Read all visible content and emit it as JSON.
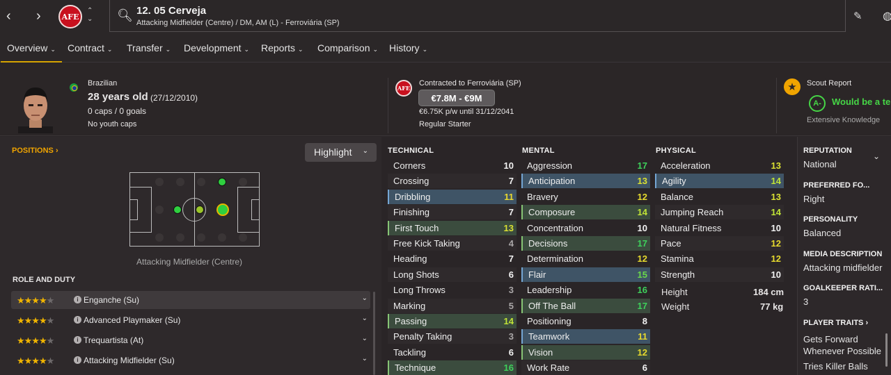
{
  "header": {
    "name": "12. 05 Cerveja",
    "subtitle": "Attacking Midfielder (Centre) / DM, AM (L) - Ferroviária (SP)",
    "club_crest": "AFE"
  },
  "tabs": [
    {
      "label": "Overview"
    },
    {
      "label": "Contract"
    },
    {
      "label": "Transfer"
    },
    {
      "label": "Development"
    },
    {
      "label": "Reports"
    },
    {
      "label": "Comparison"
    },
    {
      "label": "History"
    }
  ],
  "profile": {
    "nationality": "Brazilian",
    "age": "28 years old",
    "dob": "(27/12/2010)",
    "caps": "0 caps / 0 goals",
    "youth_caps": "No youth caps"
  },
  "contract": {
    "club": "Contracted to Ferroviária (SP)",
    "value": "€7.8M - €9M",
    "wage": "€6.75K p/w until 31/12/2041",
    "status": "Regular Starter"
  },
  "scout": {
    "title": "Scout Report",
    "grade": "A-",
    "summary": "Would be a ter",
    "knowledge": "Extensive Knowledge"
  },
  "positions": {
    "title": "POSITIONS",
    "highlight": "Highlight",
    "label": "Attacking Midfielder (Centre)"
  },
  "roles": {
    "title": "ROLE AND DUTY",
    "items": [
      {
        "name": "Enganche (Su)",
        "stars": 4
      },
      {
        "name": "Advanced Playmaker (Su)",
        "stars": 4
      },
      {
        "name": "Trequartista (At)",
        "stars": 4
      },
      {
        "name": "Attacking Midfielder (Su)",
        "stars": 4
      }
    ]
  },
  "technical": {
    "title": "TECHNICAL",
    "items": [
      {
        "name": "Corners",
        "value": "10",
        "hl": ""
      },
      {
        "name": "Crossing",
        "value": "7",
        "hl": ""
      },
      {
        "name": "Dribbling",
        "value": "11",
        "hl": "blue"
      },
      {
        "name": "Finishing",
        "value": "7",
        "hl": ""
      },
      {
        "name": "First Touch",
        "value": "13",
        "hl": "green"
      },
      {
        "name": "Free Kick Taking",
        "value": "4",
        "hl": ""
      },
      {
        "name": "Heading",
        "value": "7",
        "hl": ""
      },
      {
        "name": "Long Shots",
        "value": "6",
        "hl": ""
      },
      {
        "name": "Long Throws",
        "value": "3",
        "hl": ""
      },
      {
        "name": "Marking",
        "value": "5",
        "hl": ""
      },
      {
        "name": "Passing",
        "value": "14",
        "hl": "green"
      },
      {
        "name": "Penalty Taking",
        "value": "3",
        "hl": ""
      },
      {
        "name": "Tackling",
        "value": "6",
        "hl": ""
      },
      {
        "name": "Technique",
        "value": "16",
        "hl": "green"
      }
    ]
  },
  "mental": {
    "title": "MENTAL",
    "items": [
      {
        "name": "Aggression",
        "value": "17",
        "hl": ""
      },
      {
        "name": "Anticipation",
        "value": "13",
        "hl": "blue"
      },
      {
        "name": "Bravery",
        "value": "12",
        "hl": ""
      },
      {
        "name": "Composure",
        "value": "14",
        "hl": "green"
      },
      {
        "name": "Concentration",
        "value": "10",
        "hl": ""
      },
      {
        "name": "Decisions",
        "value": "17",
        "hl": "green"
      },
      {
        "name": "Determination",
        "value": "12",
        "hl": ""
      },
      {
        "name": "Flair",
        "value": "15",
        "hl": "blue"
      },
      {
        "name": "Leadership",
        "value": "16",
        "hl": ""
      },
      {
        "name": "Off The Ball",
        "value": "17",
        "hl": "green"
      },
      {
        "name": "Positioning",
        "value": "8",
        "hl": ""
      },
      {
        "name": "Teamwork",
        "value": "11",
        "hl": "blue"
      },
      {
        "name": "Vision",
        "value": "12",
        "hl": "green"
      },
      {
        "name": "Work Rate",
        "value": "6",
        "hl": ""
      }
    ]
  },
  "physical": {
    "title": "PHYSICAL",
    "items": [
      {
        "name": "Acceleration",
        "value": "13",
        "hl": ""
      },
      {
        "name": "Agility",
        "value": "14",
        "hl": "blue"
      },
      {
        "name": "Balance",
        "value": "13",
        "hl": ""
      },
      {
        "name": "Jumping Reach",
        "value": "14",
        "hl": ""
      },
      {
        "name": "Natural Fitness",
        "value": "10",
        "hl": ""
      },
      {
        "name": "Pace",
        "value": "12",
        "hl": ""
      },
      {
        "name": "Stamina",
        "value": "12",
        "hl": ""
      },
      {
        "name": "Strength",
        "value": "10",
        "hl": ""
      }
    ],
    "height_label": "Height",
    "height": "184 cm",
    "weight_label": "Weight",
    "weight": "77 kg"
  },
  "side": {
    "reputation_h": "REPUTATION",
    "reputation": "National",
    "foot_h": "PREFERRED FO...",
    "foot": "Right",
    "personality_h": "PERSONALITY",
    "personality": "Balanced",
    "media_h": "MEDIA DESCRIPTION",
    "media": "Attacking midfielder",
    "gk_h": "GOALKEEPER RATI...",
    "gk": "3",
    "traits_h": "PLAYER TRAITS",
    "traits": [
      "Gets Forward",
      "Whenever Possible",
      "Tries Killer Balls"
    ]
  },
  "colors": {
    "accent": "#d6a400",
    "positions_title": "#f0a400",
    "crest": "#c8101e"
  }
}
